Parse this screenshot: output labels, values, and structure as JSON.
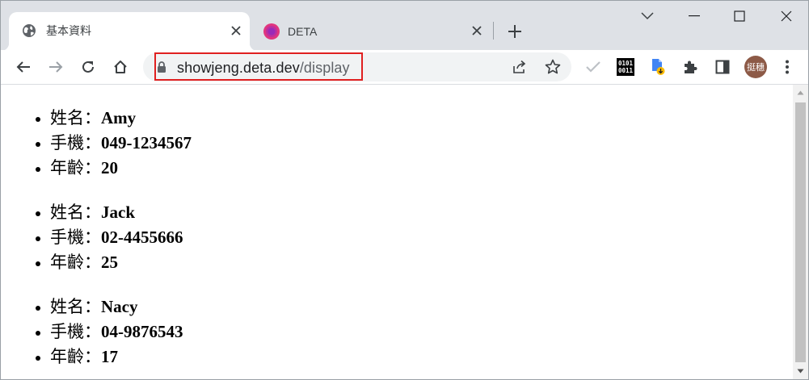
{
  "tabs": [
    {
      "title": "基本資料",
      "active": true,
      "favicon": "globe-icon"
    },
    {
      "title": "DETA",
      "active": false,
      "favicon": "deta-icon"
    }
  ],
  "omnibox": {
    "host": "showjeng.deta.dev",
    "path": "/display"
  },
  "profile": {
    "initials": "挺穗"
  },
  "extensions": {
    "binary_label_top": "0101",
    "binary_label_bottom": "0011"
  },
  "colors": {
    "url_highlight": "#e02020",
    "avatar": "#8d5a47",
    "deta_accent": "#e0357f"
  },
  "people": [
    {
      "name_label": "姓名：",
      "name": "Amy",
      "phone_label": "手機：",
      "phone": "049-1234567",
      "age_label": "年齡：",
      "age": "20"
    },
    {
      "name_label": "姓名：",
      "name": "Jack",
      "phone_label": "手機：",
      "phone": "02-4455666",
      "age_label": "年齡：",
      "age": "25"
    },
    {
      "name_label": "姓名：",
      "name": "Nacy",
      "phone_label": "手機：",
      "phone": "04-9876543",
      "age_label": "年齡：",
      "age": "17"
    }
  ]
}
